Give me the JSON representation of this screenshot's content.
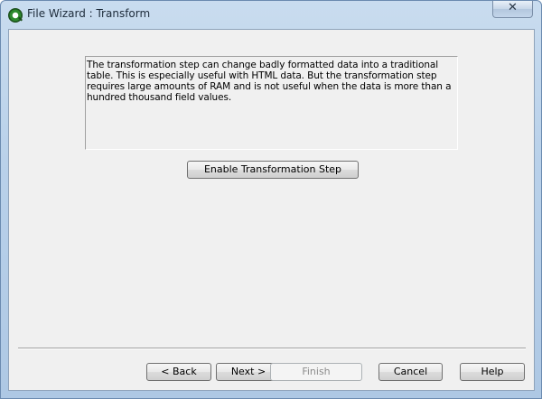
{
  "window": {
    "title": "File Wizard : Transform",
    "close_glyph": "✕",
    "app_icon": "qlikview-icon"
  },
  "main": {
    "description": "The transformation step can change badly formatted data into a traditional table. This is especially useful with HTML data. But the transformation step requires large amounts of RAM and is not useful when the data is more than a hundred thousand field values.",
    "enable_button": "Enable Transformation Step"
  },
  "footer": {
    "back": "< Back",
    "next": "Next >",
    "finish": "Finish",
    "finish_enabled": false,
    "cancel": "Cancel",
    "help": "Help"
  }
}
